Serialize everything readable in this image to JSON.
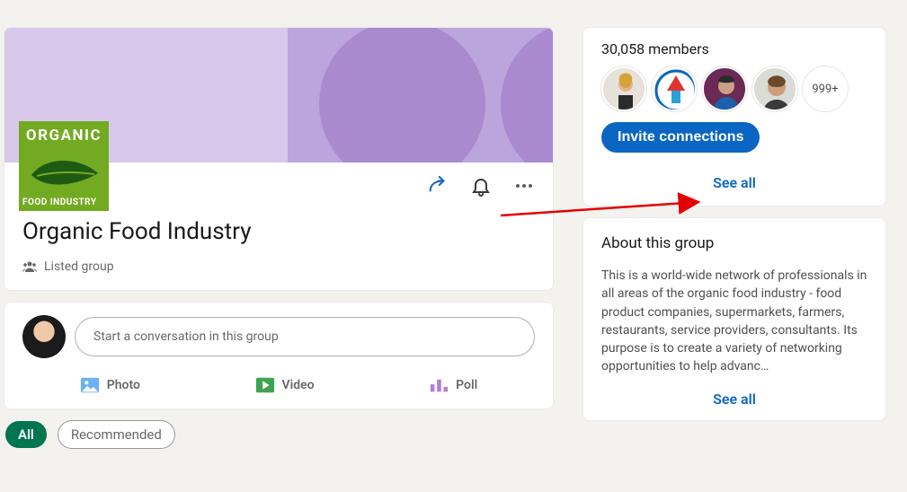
{
  "header": {
    "title": "Organic Food Industry",
    "listed_label": "Listed group",
    "logo_top": "ORGANIC",
    "logo_bottom": "FOOD INDUSTRY"
  },
  "compose": {
    "placeholder": "Start a conversation in this group",
    "photo_label": "Photo",
    "video_label": "Video",
    "poll_label": "Poll"
  },
  "filters": {
    "all": "All",
    "recommended": "Recommended"
  },
  "members": {
    "count_label": "30,058 members",
    "more_label": "999+",
    "invite_label": "Invite connections",
    "see_all": "See all"
  },
  "about": {
    "title": "About this group",
    "body": "This is a world-wide network of professionals in all areas of the organic food industry - food product companies, supermarkets, farmers, restaurants, service providers, consultants. Its purpose is to create a variety of networking opportunities to help advanc…",
    "see_all": "See all"
  }
}
